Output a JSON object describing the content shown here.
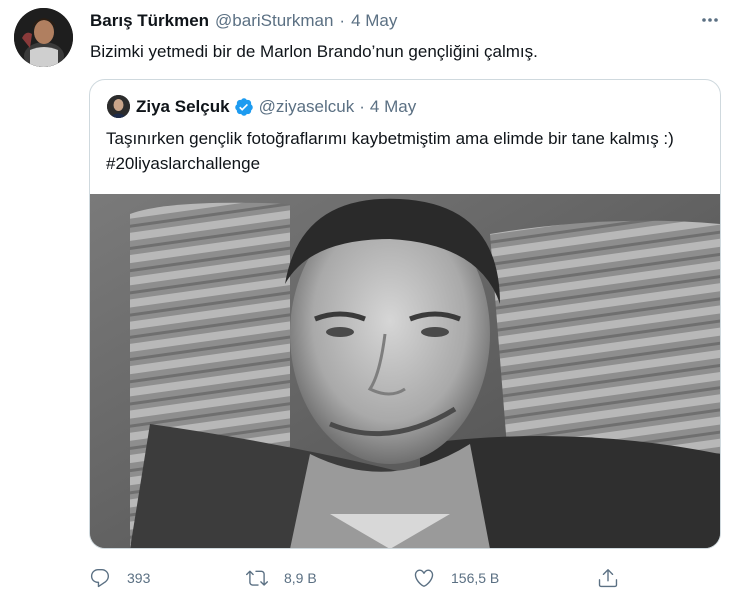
{
  "tweet": {
    "author_name": "Barış Türkmen",
    "author_handle": "@bariSturkman",
    "separator": "·",
    "date": "4 May",
    "text": "Bizimki yetmedi bir de Marlon Brando’nun gençliğini çalmış."
  },
  "quoted_tweet": {
    "author_name": "Ziya Selçuk",
    "author_handle": "@ziyaselcuk",
    "separator": "·",
    "date": "4 May",
    "text": "Taşınırken gençlik fotoğraflarımı kaybetmiştim ama elimde bir tane kalmış :) #20liyaslarchallenge",
    "verified": true,
    "image_description_icon": "photo-image"
  },
  "actions": {
    "reply_count": "393",
    "retweet_count": "8,9 B",
    "like_count": "156,5 B"
  },
  "colors": {
    "text_primary": "#0f1419",
    "text_secondary": "#5b7083",
    "border": "#cfd9de",
    "verified_blue": "#1d9bf0"
  }
}
